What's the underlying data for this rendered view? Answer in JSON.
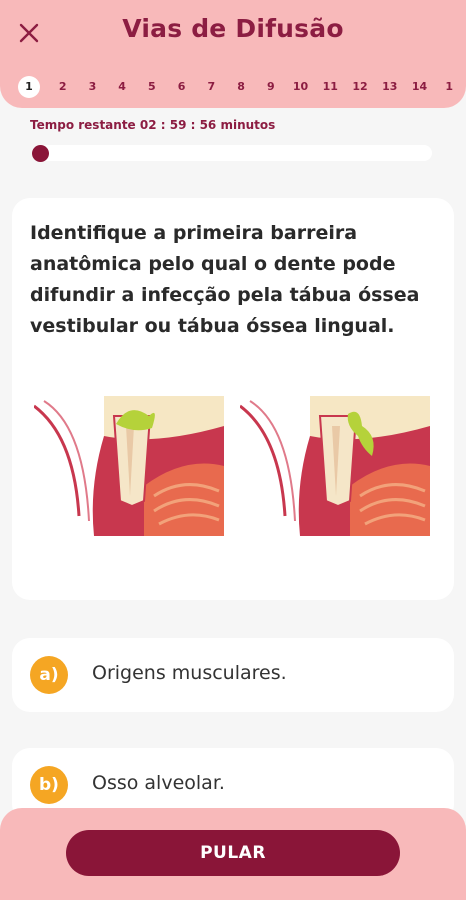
{
  "header": {
    "title": "Vias de Difusão",
    "close_icon": "close-icon",
    "steps": [
      "1",
      "2",
      "3",
      "4",
      "5",
      "6",
      "7",
      "8",
      "9",
      "10",
      "11",
      "12",
      "13",
      "14",
      "1"
    ],
    "active_step": 1
  },
  "timer": {
    "label": "Tempo restante 02 : 59 : 56 minutos",
    "progress": 0.0
  },
  "question": {
    "text": "Identifique a primeira barreira anatômica pelo qual o dente pode difundir a infecção pela tábua óssea vestibular ou tábua óssea lingual.",
    "images": [
      "tooth-infection-spread-illustration",
      "tooth-infection-spread-illustration"
    ]
  },
  "options": [
    {
      "letter": "a)",
      "text": "Origens musculares."
    },
    {
      "letter": "b)",
      "text": "Osso alveolar."
    }
  ],
  "footer": {
    "skip_label": "PULAR"
  },
  "colors": {
    "accent": "#8a1538",
    "header_bg": "#f8b9ba",
    "badge": "#f5a623",
    "background": "#f6f6f6"
  }
}
